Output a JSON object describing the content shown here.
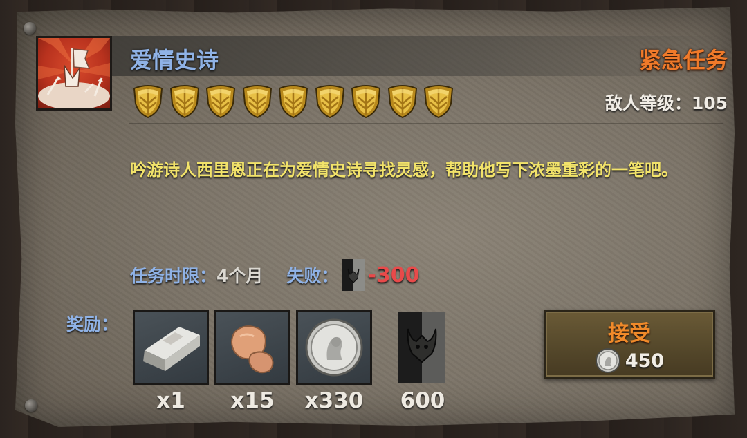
{
  "quest": {
    "title": "爱情史诗",
    "urgent_label": "紧急任务",
    "enemy_level": "敌人等级：105",
    "rank_shields": 9,
    "description": "吟游诗人西里恩正在为爱情史诗寻找灵感，帮助他写下浓墨重彩的一笔吧。",
    "time_limit_label": "任务时限：",
    "time_limit_value": "4个月",
    "fail_label": "失败：",
    "fail_value": "-300"
  },
  "rewards": {
    "label": "奖励：",
    "items": [
      {
        "icon": "silver-ingot-icon",
        "qty": "x1"
      },
      {
        "icon": "copper-ore-icon",
        "qty": "x15"
      },
      {
        "icon": "silver-coin-icon",
        "qty": "x330"
      },
      {
        "icon": "faction-banner-icon",
        "qty": "600"
      }
    ]
  },
  "accept_button": {
    "label": "接受",
    "cost_icon": "silver-coin-icon",
    "cost_value": "450"
  },
  "colors": {
    "title_blue": "#8fb2e6",
    "urgent_orange": "#f07a2a",
    "description_yellow": "#f2e36a",
    "fail_red": "#e84a4a"
  }
}
